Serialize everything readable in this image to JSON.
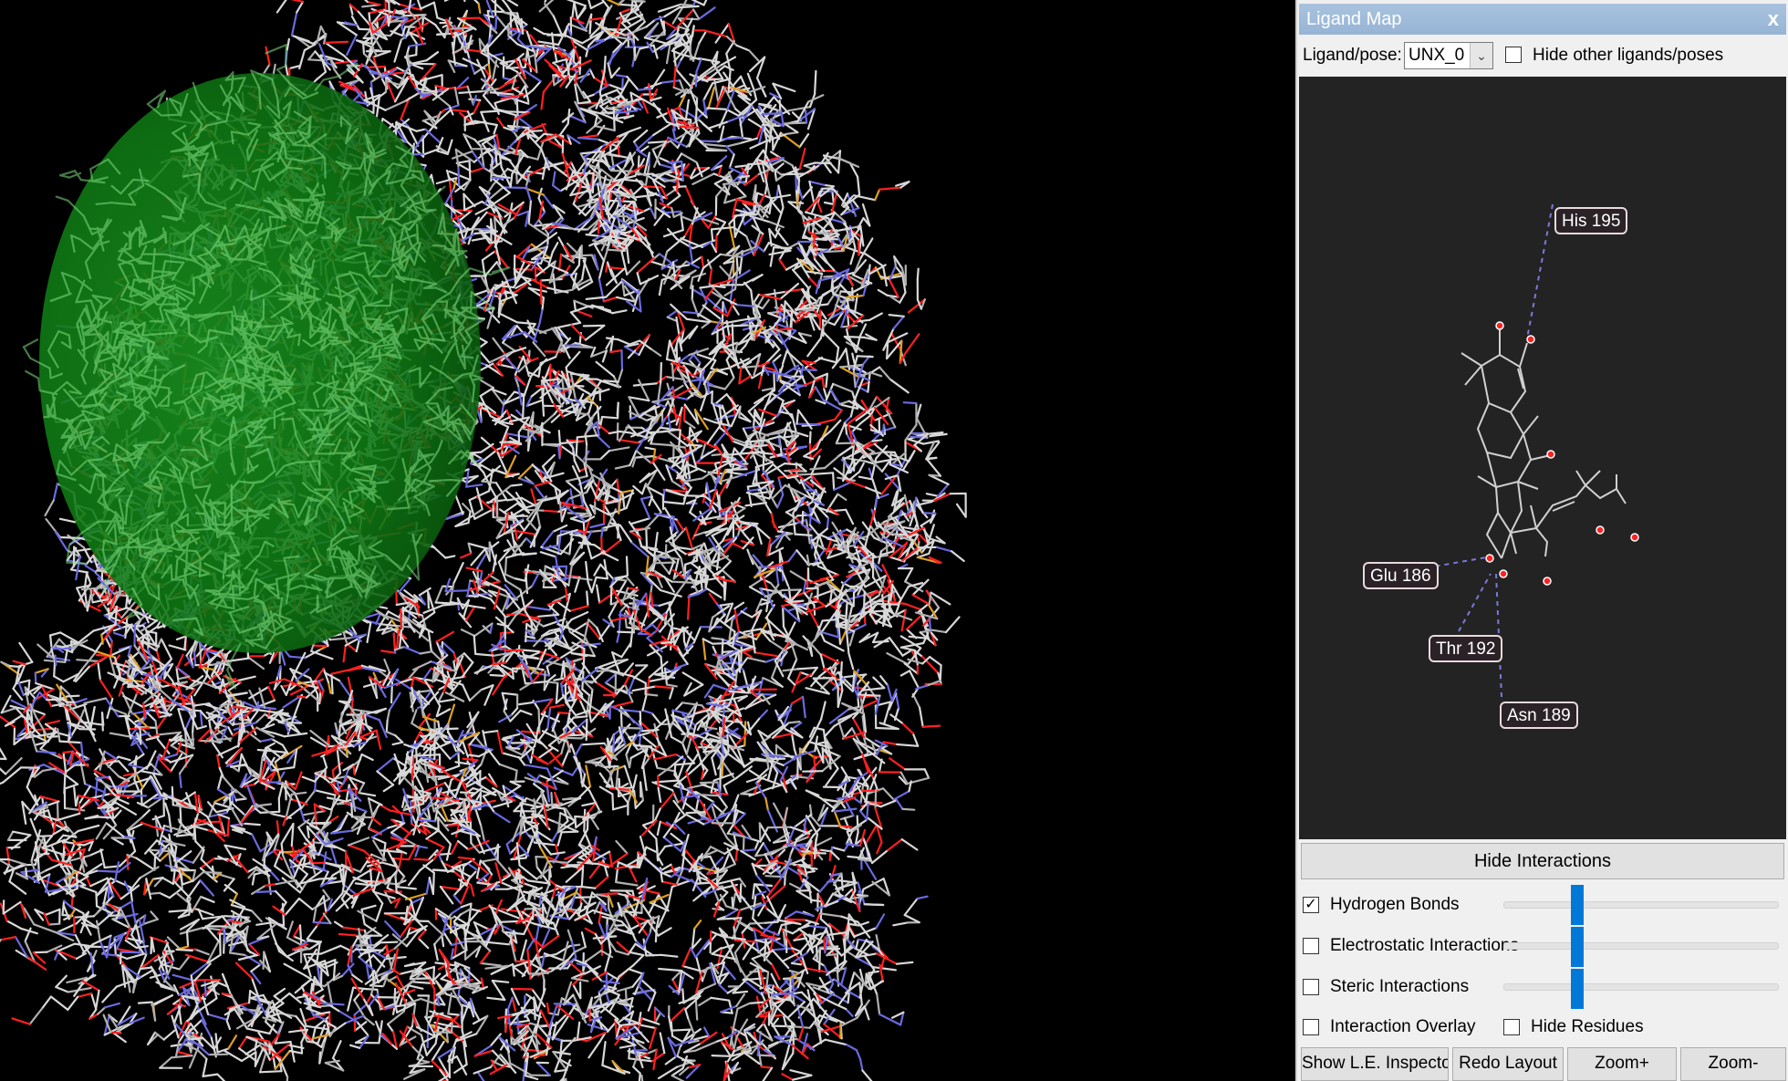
{
  "panel": {
    "title": "Ligand Map",
    "close_glyph": "x",
    "ligand_label": "Ligand/pose:",
    "ligand_value": "UNX_0",
    "hide_other_label": "Hide other ligands/poses",
    "hide_other_checked": false
  },
  "map": {
    "residues": [
      {
        "name": "His 195"
      },
      {
        "name": "Glu 186"
      },
      {
        "name": "Thr 192"
      },
      {
        "name": "Asn 189"
      }
    ],
    "interaction_color": "#7a7adf",
    "oxygen_color": "#ff2020"
  },
  "controls": {
    "hide_interactions_label": "Hide Interactions",
    "hydrogen_bonds": {
      "label": "Hydrogen Bonds",
      "checked": true
    },
    "electrostatic": {
      "label": "Electrostatic Interactions",
      "checked": false
    },
    "steric": {
      "label": "Steric Interactions",
      "checked": false
    },
    "interaction_overlay": {
      "label": "Interaction Overlay",
      "checked": false
    },
    "hide_residues": {
      "label": "Hide Residues",
      "checked": false
    },
    "slider_color": "#0078d7"
  },
  "buttons": {
    "show_le_inspector": "Show L.E. Inspector",
    "redo_layout": "Redo Layout",
    "zoom_in": "Zoom+",
    "zoom_out": "Zoom-"
  },
  "viewport": {
    "sphere_color": "#0d7a12",
    "atom_colors": [
      "#d8d8d8",
      "#b0b0b0",
      "#ff2020",
      "#6a6adf",
      "#e0a020"
    ]
  },
  "icons": {
    "dropdown": "chevron-down-icon",
    "check": "check-icon",
    "close": "close-icon"
  }
}
